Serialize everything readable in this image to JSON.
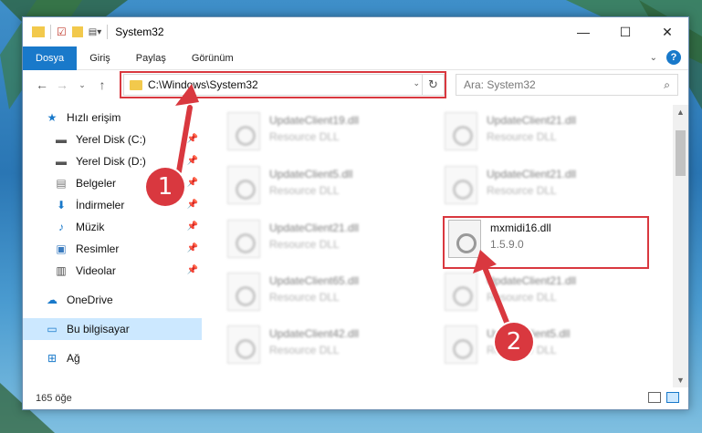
{
  "window": {
    "title": "System32",
    "controls": {
      "minimize": "—",
      "maximize": "☐",
      "close": "✕"
    }
  },
  "ribbon": {
    "tabs": [
      {
        "label": "Dosya",
        "active": true
      },
      {
        "label": "Giriş",
        "active": false
      },
      {
        "label": "Paylaş",
        "active": false
      },
      {
        "label": "Görünüm",
        "active": false
      }
    ]
  },
  "navigation": {
    "address": "C:\\Windows\\System32",
    "search_placeholder": "Ara: System32"
  },
  "sidebar": {
    "items": [
      {
        "label": "Hızlı erişim",
        "icon": "star-icon",
        "pinned": false
      },
      {
        "label": "Yerel Disk (C:)",
        "icon": "drive-icon",
        "pinned": true
      },
      {
        "label": "Yerel Disk (D:)",
        "icon": "drive-icon",
        "pinned": true
      },
      {
        "label": "Belgeler",
        "icon": "documents-icon",
        "pinned": true
      },
      {
        "label": "İndirmeler",
        "icon": "download-icon",
        "pinned": true
      },
      {
        "label": "Müzik",
        "icon": "music-icon",
        "pinned": true
      },
      {
        "label": "Resimler",
        "icon": "pictures-icon",
        "pinned": true
      },
      {
        "label": "Videolar",
        "icon": "videos-icon",
        "pinned": true
      },
      {
        "label": "OneDrive",
        "icon": "cloud-icon",
        "pinned": false
      },
      {
        "label": "Bu bilgisayar",
        "icon": "computer-icon",
        "pinned": false,
        "selected": true
      },
      {
        "label": "Ağ",
        "icon": "network-icon",
        "pinned": false
      }
    ]
  },
  "files": [
    {
      "name": "UpdateClient19.dll",
      "sub": "Resource DLL",
      "blurred": true
    },
    {
      "name": "UpdateClient21.dll",
      "sub": "Resource DLL",
      "blurred": true
    },
    {
      "name": "UpdateClient5.dll",
      "sub": "Resource DLL",
      "blurred": true
    },
    {
      "name": "UpdateClient21.dll",
      "sub": "Resource DLL",
      "blurred": true
    },
    {
      "name": "UpdateClient21.dll",
      "sub": "Resource DLL",
      "blurred": true
    },
    {
      "name": "mxmidi16.dll",
      "sub": "1.5.9.0",
      "blurred": false
    },
    {
      "name": "UpdateClient65.dll",
      "sub": "Resource DLL",
      "blurred": true
    },
    {
      "name": "UpdateClient21.dll",
      "sub": "Resource DLL",
      "blurred": true
    },
    {
      "name": "UpdateClient42.dll",
      "sub": "Resource DLL",
      "blurred": true
    },
    {
      "name": "UpdateClient5.dll",
      "sub": "Resource DLL",
      "blurred": true
    }
  ],
  "status": {
    "count": "165 öğe"
  },
  "annotations": {
    "badge1": "1",
    "badge2": "2"
  },
  "colors": {
    "accent": "#1979ca",
    "highlight": "#d9383f",
    "selected_bg": "#cce8ff"
  }
}
